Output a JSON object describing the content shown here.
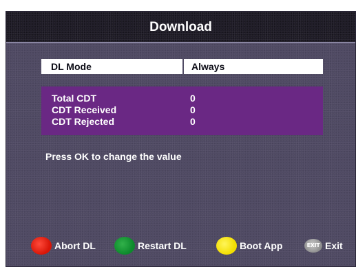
{
  "header": {
    "title": "Download"
  },
  "settings": {
    "mode_label": "DL Mode",
    "mode_value": "Always"
  },
  "stats": [
    {
      "label": "Total CDT",
      "value": "0"
    },
    {
      "label": "CDT Received",
      "value": "0"
    },
    {
      "label": "CDT Rejected",
      "value": "0"
    }
  ],
  "hint": "Press OK to change the value",
  "footer": {
    "buttons": [
      {
        "icon": "red-button-icon",
        "color": "#e0200f",
        "label": "Abort DL"
      },
      {
        "icon": "green-button-icon",
        "color": "#119332",
        "label": "Restart DL"
      },
      {
        "icon": "yellow-button-icon",
        "color": "#f5e100",
        "label": "Boot App"
      },
      {
        "icon": "exit-button-icon",
        "color": "#9a9a9a",
        "icon_text": "EXIT",
        "label": "Exit"
      }
    ]
  },
  "colors": {
    "background": "#4f4a63",
    "header": "#1e1b26",
    "stats_panel": "#6a2884"
  }
}
